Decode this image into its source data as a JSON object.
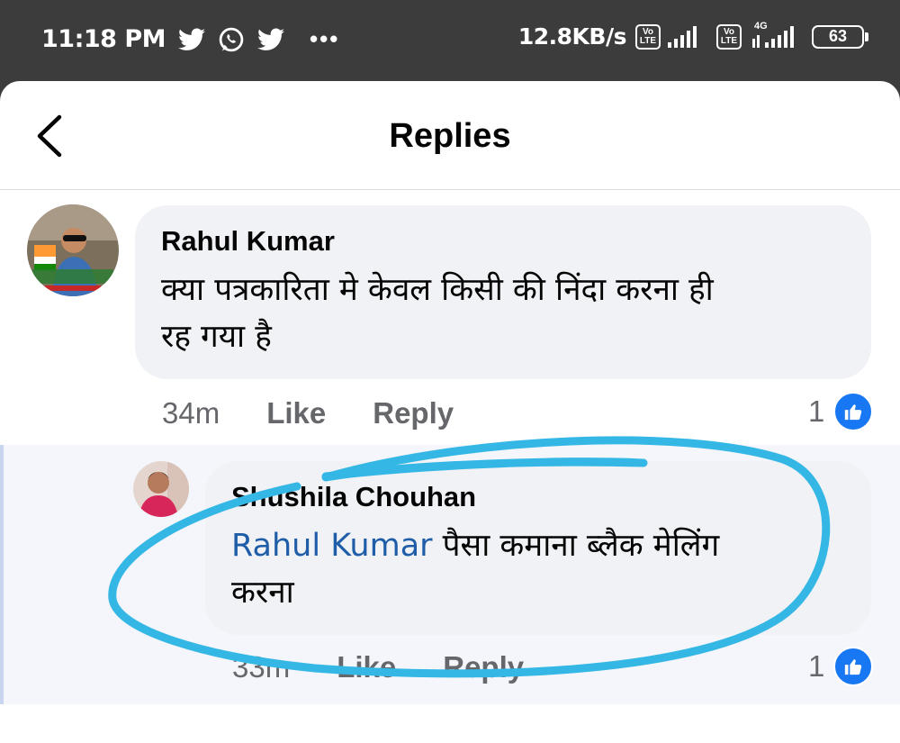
{
  "status_bar": {
    "time": "11:18 PM",
    "notification_icons": [
      "twitter-icon",
      "whatsapp-icon",
      "twitter-icon"
    ],
    "more": "•••",
    "net_speed": "12.8KB/s",
    "sim1_tag": "Vo LTE",
    "sim2_tag": "Vo LTE",
    "network_type": "4G",
    "battery": "63"
  },
  "header": {
    "title": "Replies",
    "back_icon": "chevron-left-icon"
  },
  "comment": {
    "author": "Rahul Kumar",
    "text_line1": "क्या पत्रकारिता मे केवल किसी की निंदा करना ही",
    "text_line2": "रह गया है",
    "time": "34m",
    "like_label": "Like",
    "reply_label": "Reply",
    "reaction_count": "1"
  },
  "reply": {
    "author": "Shushila Chouhan",
    "mention": "Rahul Kumar",
    "text_line1_rest": " पैसा कमाना ब्लैक मेलिंग",
    "text_line2": "करना",
    "time": "33m",
    "like_label": "Like",
    "reply_label": "Reply",
    "reaction_count": "1"
  },
  "colors": {
    "bubble": "#f0f2f5",
    "link": "#1f5da8",
    "like_badge": "#1877f2",
    "annotation_stroke": "#35b7e6"
  }
}
